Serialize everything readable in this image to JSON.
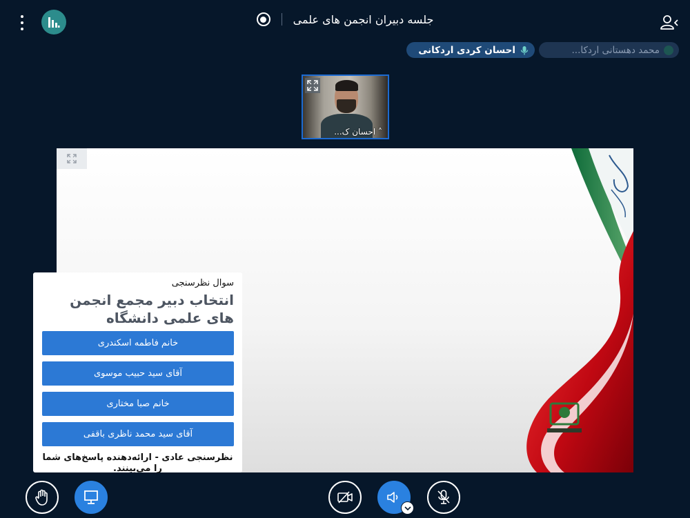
{
  "meeting": {
    "title": "جلسه دبیران انجمن های علمی"
  },
  "talkers": [
    {
      "name": "محمد دهستانی اردکا..."
    },
    {
      "name": "احسان کردی اردکانی"
    }
  ],
  "webcam": {
    "name": "احسان ک..."
  },
  "poll": {
    "heading": "سوال نظرسنجی",
    "question": "انتخاب دبیر مجمع انجمن های علمی دانشگاه",
    "options": [
      "خانم فاطمه اسکندری",
      "آقای سید حبیب موسوی",
      "خانم صبا مختاری",
      "آقای سید محمد ناظری باقفی"
    ],
    "note": "نظرسنجی عادی - ارائه‌دهنده پاسخ‌های شما را می‌بینند."
  },
  "colors": {
    "background": "#06172a",
    "accent": "#2a81e0",
    "poll_button": "#2c79d5"
  },
  "icons": {
    "menu": "vertical-dots-icon",
    "stats": "bar-chart-icon",
    "record": "record-icon",
    "users": "user-list-icon",
    "raise_hand": "hand-icon",
    "presentation": "presentation-icon",
    "video_off": "video-off-icon",
    "audio": "speaker-icon",
    "mic_off": "mic-off-icon"
  }
}
